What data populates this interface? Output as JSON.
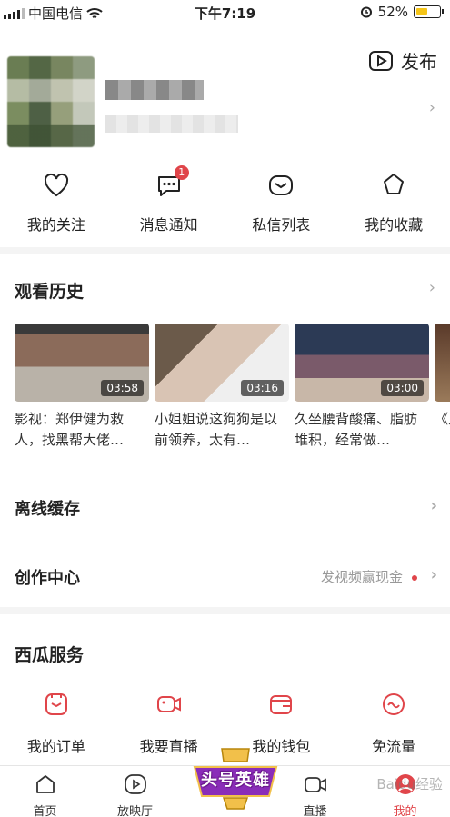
{
  "status_bar": {
    "carrier": "中国电信",
    "time": "下午7:19",
    "battery": "52%",
    "battery_fraction": 0.52
  },
  "header": {
    "publish_label": "发布"
  },
  "quick_actions": [
    {
      "label": "我的关注",
      "icon": "heart-icon"
    },
    {
      "label": "消息通知",
      "icon": "message-icon",
      "badge": "1"
    },
    {
      "label": "私信列表",
      "icon": "envelope-icon"
    },
    {
      "label": "我的收藏",
      "icon": "star-icon"
    }
  ],
  "history": {
    "title": "观看历史",
    "items": [
      {
        "duration": "03:58",
        "title": "影视：郑伊健为救人，找黑帮大佬…"
      },
      {
        "duration": "03:16",
        "title": "小姐姐说这狗狗是以前领养，太有…"
      },
      {
        "duration": "03:00",
        "title": "久坐腰背酸痛、脂肪堆积，经常做…"
      },
      {
        "duration": "",
        "title": "《人"
      }
    ]
  },
  "offline_cache": {
    "label": "离线缓存"
  },
  "creator_center": {
    "label": "创作中心",
    "promo": "发视频赢现金"
  },
  "services": {
    "title": "西瓜服务",
    "items": [
      {
        "label": "我的订单",
        "icon": "order-icon"
      },
      {
        "label": "我要直播",
        "icon": "live-camera-icon"
      },
      {
        "label": "我的钱包",
        "icon": "wallet-icon"
      },
      {
        "label": "免流量",
        "icon": "free-data-icon"
      }
    ]
  },
  "tabbar": [
    {
      "label": "首页",
      "icon": "home-icon"
    },
    {
      "label": "放映厅",
      "icon": "play-icon"
    },
    {
      "label": "",
      "icon": ""
    },
    {
      "label": "直播",
      "icon": "live-icon"
    },
    {
      "label": "我的",
      "icon": "profile-icon",
      "active": true
    }
  ],
  "promo_badge": {
    "text": "头号英雄"
  },
  "watermark": "Baidu经验",
  "colors": {
    "accent": "#e0454a",
    "battery": "#f5c518"
  }
}
